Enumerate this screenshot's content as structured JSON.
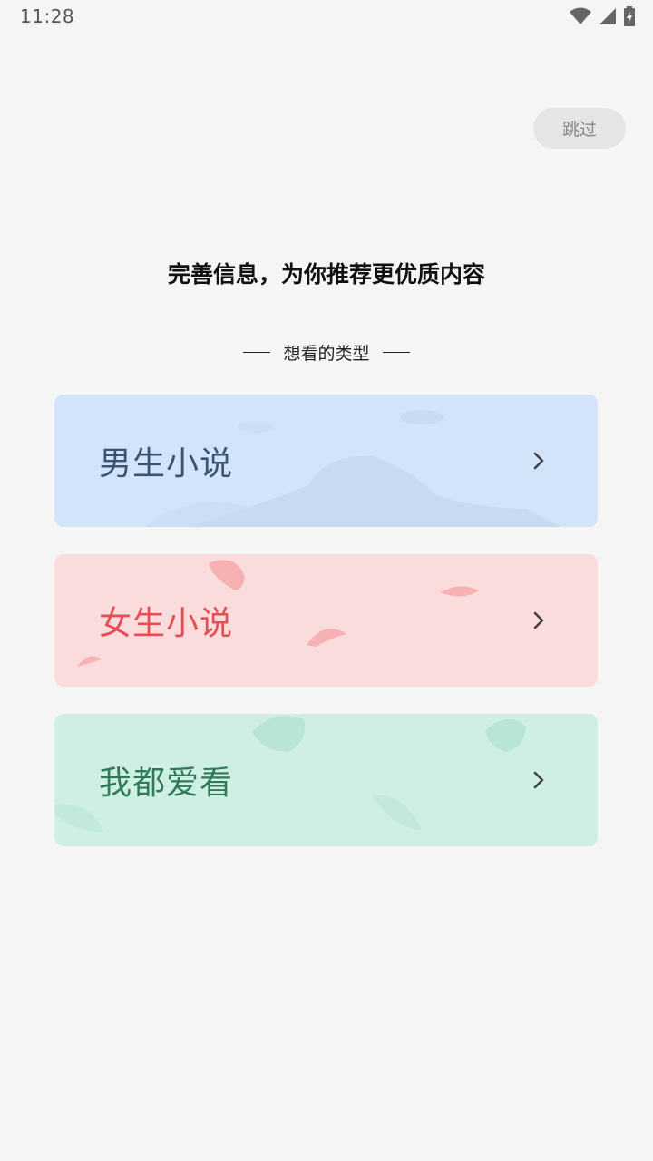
{
  "status_bar": {
    "time": "11:28",
    "icons": [
      "wifi-icon",
      "cell-signal-icon",
      "battery-charging-icon"
    ]
  },
  "header": {
    "skip_label": "跳过"
  },
  "main": {
    "title": "完善信息，为你推荐更优质内容",
    "section_label": "想看的类型",
    "cards": [
      {
        "label": "男生小说",
        "text_color": "#3a5474",
        "bg_color": "#d3e3f9",
        "icon": "chevron-right-icon"
      },
      {
        "label": "女生小说",
        "text_color": "#e44f53",
        "bg_color": "#fbdcdd",
        "icon": "chevron-right-icon"
      },
      {
        "label": "我都爱看",
        "text_color": "#2f7a58",
        "bg_color": "#d0efe4",
        "icon": "chevron-right-icon"
      }
    ]
  },
  "colors": {
    "page_bg": "#f5f5f5",
    "skip_bg": "#e5e5e5",
    "skip_text": "#8a8a8a",
    "title_text": "#111111"
  }
}
